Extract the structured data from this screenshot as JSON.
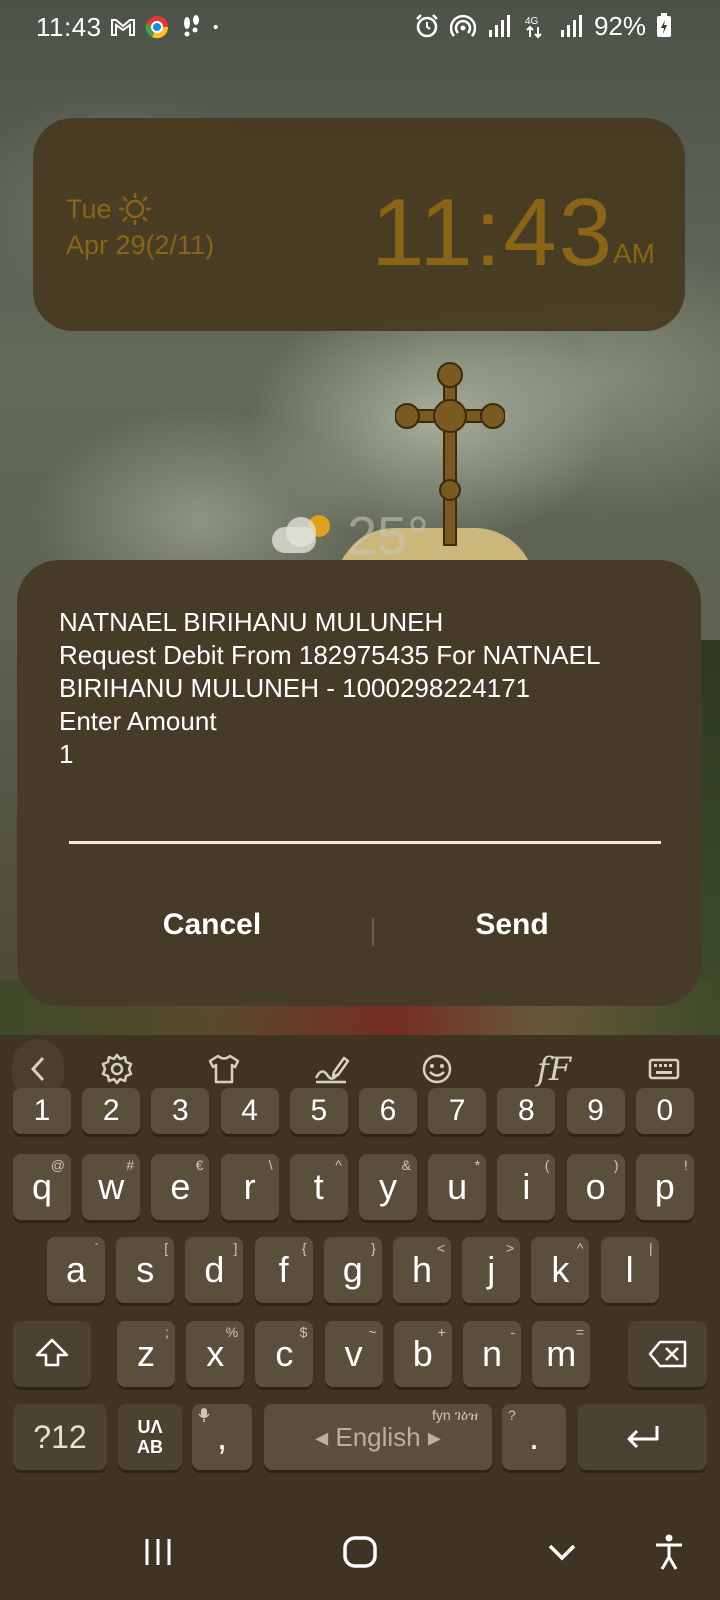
{
  "status_bar": {
    "time": "11:43",
    "battery": "92%",
    "network": "4G"
  },
  "clock_widget": {
    "day": "Tue",
    "date": "Apr 29(2/11)",
    "time": "11:43",
    "ampm": "AM"
  },
  "wallpaper_weather": {
    "temperature": "25°"
  },
  "dialog": {
    "lines": [
      "NATNAEL BIRIHANU MULUNEH",
      "Request Debit From 182975435 For NATNAEL",
      "BIRIHANU MULUNEH - 1000298224171",
      "Enter Amount",
      "1"
    ],
    "input_value": "",
    "cancel_label": "Cancel",
    "send_label": "Send"
  },
  "keyboard": {
    "toolbar_icons": [
      "chevron-left-icon",
      "gear-icon",
      "tshirt-icon",
      "handwriting-icon",
      "emoji-icon",
      "font-style-icon",
      "keyboard-icon"
    ],
    "font_style_label": "fF",
    "number_row": [
      "1",
      "2",
      "3",
      "4",
      "5",
      "6",
      "7",
      "8",
      "9",
      "0"
    ],
    "row1": [
      {
        "key": "q",
        "sub": "@"
      },
      {
        "key": "w",
        "sub": "#"
      },
      {
        "key": "e",
        "sub": "€"
      },
      {
        "key": "r",
        "sub": "\\"
      },
      {
        "key": "t",
        "sub": "^"
      },
      {
        "key": "y",
        "sub": "&"
      },
      {
        "key": "u",
        "sub": "*"
      },
      {
        "key": "i",
        "sub": "("
      },
      {
        "key": "o",
        "sub": ")"
      },
      {
        "key": "p",
        "sub": "!"
      }
    ],
    "row2": [
      {
        "key": "a",
        "sub": "`"
      },
      {
        "key": "s",
        "sub": "["
      },
      {
        "key": "d",
        "sub": "]"
      },
      {
        "key": "f",
        "sub": "{"
      },
      {
        "key": "g",
        "sub": "}"
      },
      {
        "key": "h",
        "sub": "<"
      },
      {
        "key": "j",
        "sub": ">"
      },
      {
        "key": "k",
        "sub": "^"
      },
      {
        "key": "l",
        "sub": "|"
      }
    ],
    "row3": [
      {
        "key": "z",
        "sub": ";"
      },
      {
        "key": "x",
        "sub": "%"
      },
      {
        "key": "c",
        "sub": "$"
      },
      {
        "key": "v",
        "sub": "~"
      },
      {
        "key": "b",
        "sub": "+"
      },
      {
        "key": "n",
        "sub": "-"
      },
      {
        "key": "m",
        "sub": "="
      }
    ],
    "symbols_label": "?12",
    "lang_top": "UΛ",
    "lang_bottom": "AB",
    "comma": ",",
    "space_label": "English",
    "space_sub": "fyn ገዕዝ",
    "period": ".",
    "period_sub": "?"
  }
}
